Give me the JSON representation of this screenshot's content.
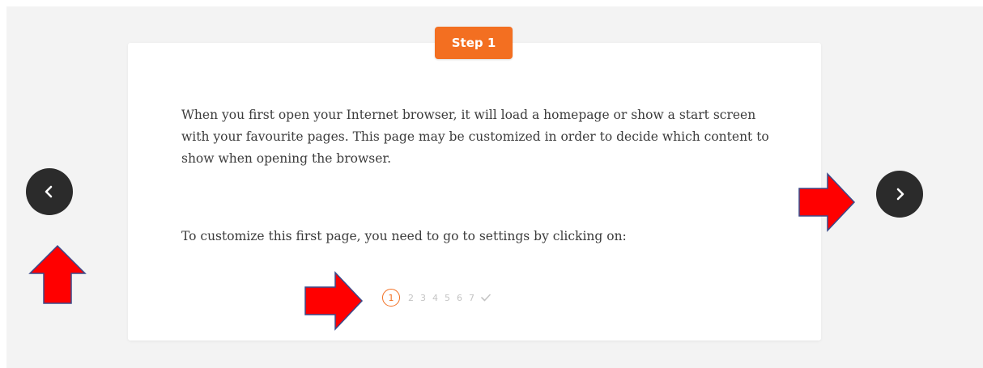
{
  "step_badge": {
    "label": "Step 1"
  },
  "content": {
    "paragraph1": "When you first open your Internet browser, it will load a homepage or show a start screen with your favourite pages. This page may be customized in order to decide which content to show when opening the browser.",
    "paragraph2": "To customize this first page, you need to go to settings by clicking on:"
  },
  "pagination": {
    "pages": [
      "1",
      "2",
      "3",
      "4",
      "5",
      "6",
      "7"
    ],
    "active_page": "1",
    "final_icon": "check-icon"
  },
  "navigation": {
    "prev_icon": "chevron-left-icon",
    "next_icon": "chevron-right-icon"
  },
  "annotations": {
    "arrow_color": "#ff0000",
    "arrow_outline": "#3a4a8a",
    "arrows": [
      "arrow-up-icon",
      "arrow-right-icon",
      "arrow-right-icon"
    ]
  },
  "colors": {
    "accent": "#f36f21",
    "nav_button": "#2b2b2b",
    "background": "#f3f3f3",
    "card": "#ffffff",
    "text": "#3c3c3c"
  }
}
